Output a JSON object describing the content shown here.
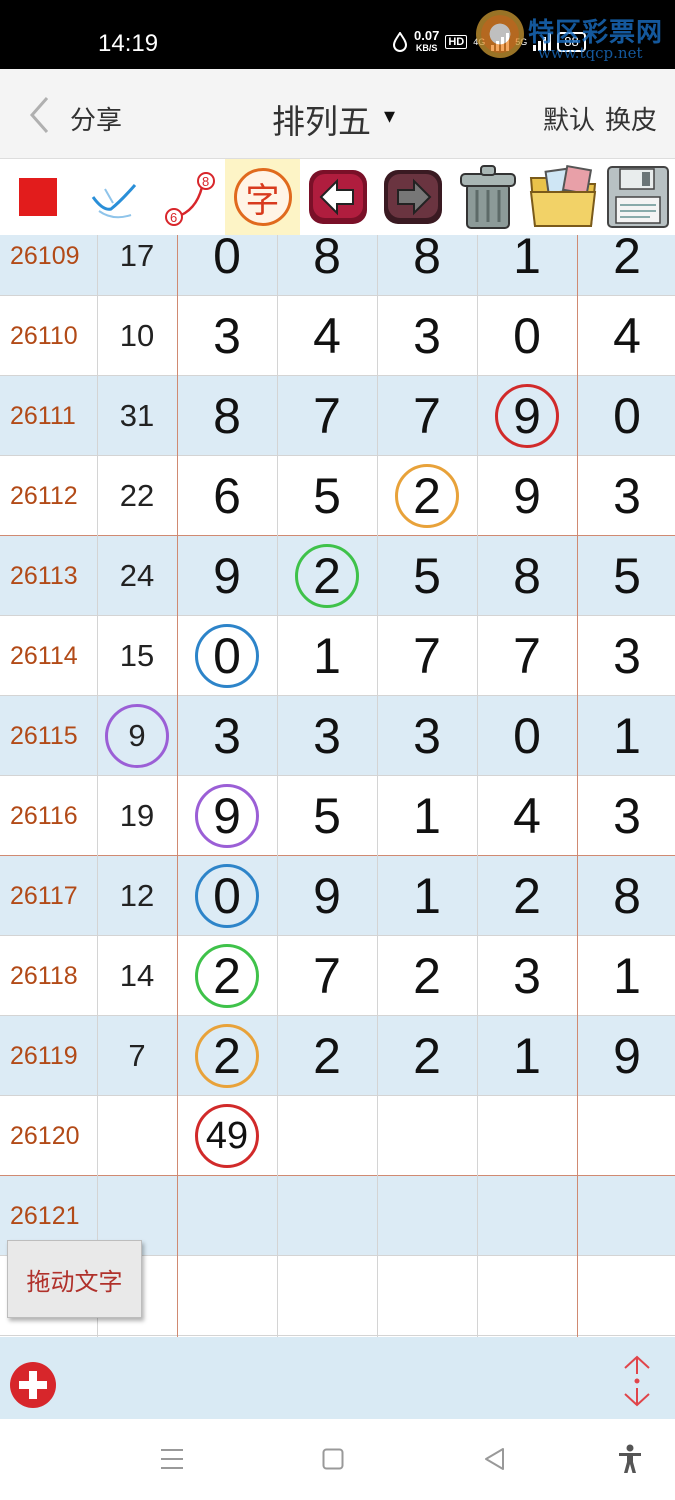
{
  "status_bar": {
    "time": "14:19",
    "net_speed": "0.07",
    "net_unit": "KB/S",
    "hd": "HD",
    "sig1": "4G",
    "sig2": "5G",
    "battery": "88"
  },
  "watermark": {
    "name": "特区彩票网",
    "url": "www.tqcp.net"
  },
  "title_bar": {
    "back_icon": "chevron-left-icon",
    "share_label": "分享",
    "title": "排列五",
    "title_arrow": "▾",
    "default_label": "默认",
    "skin_label": "换皮"
  },
  "toolbar": {
    "items": [
      "red-square-icon",
      "checkmark-icon",
      "trend-line-icon",
      "zi-character-icon",
      "arrow-left-icon",
      "arrow-right-icon",
      "trash-icon",
      "folder-images-icon",
      "floppy-save-icon"
    ],
    "trend_label_a": "8",
    "trend_label_b": "6",
    "zi_char": "字"
  },
  "table": {
    "rows": [
      {
        "period": "26109",
        "sum": "17",
        "digits": [
          "0",
          "8",
          "8",
          "1",
          "2"
        ]
      },
      {
        "period": "26110",
        "sum": "10",
        "digits": [
          "3",
          "4",
          "3",
          "0",
          "4"
        ]
      },
      {
        "period": "26111",
        "sum": "31",
        "digits": [
          "8",
          "7",
          "7",
          "9",
          "0"
        ]
      },
      {
        "period": "26112",
        "sum": "22",
        "digits": [
          "6",
          "5",
          "2",
          "9",
          "3"
        ]
      },
      {
        "period": "26113",
        "sum": "24",
        "digits": [
          "9",
          "2",
          "5",
          "8",
          "5"
        ]
      },
      {
        "period": "26114",
        "sum": "15",
        "digits": [
          "0",
          "1",
          "7",
          "7",
          "3"
        ]
      },
      {
        "period": "26115",
        "sum": "9",
        "digits": [
          "3",
          "3",
          "3",
          "0",
          "1"
        ]
      },
      {
        "period": "26116",
        "sum": "19",
        "digits": [
          "9",
          "5",
          "1",
          "4",
          "3"
        ]
      },
      {
        "period": "26117",
        "sum": "12",
        "digits": [
          "0",
          "9",
          "1",
          "2",
          "8"
        ]
      },
      {
        "period": "26118",
        "sum": "14",
        "digits": [
          "2",
          "7",
          "2",
          "3",
          "1"
        ]
      },
      {
        "period": "26119",
        "sum": "7",
        "digits": [
          "2",
          "2",
          "2",
          "1",
          "9"
        ]
      },
      {
        "period": "26120",
        "sum": "",
        "digits": [
          "49",
          "",
          "",
          "",
          ""
        ]
      },
      {
        "period": "26121",
        "sum": "",
        "digits": [
          "",
          "",
          "",
          "",
          ""
        ]
      },
      {
        "period": "",
        "sum": "",
        "digits": [
          "",
          "",
          "",
          "",
          ""
        ]
      }
    ],
    "circle_colors": {
      "red": "#d12a2a",
      "orange": "#e8a23a",
      "green": "#3fc24a",
      "blue": "#2d84c9",
      "purple": "#9b5fd6"
    }
  },
  "drag_button": {
    "label": "拖动文字"
  },
  "bottom_bar": {
    "add_icon": "plus-circle-icon",
    "updown_icon": "up-down-arrows-icon"
  },
  "nav_bar": {
    "items": [
      "menu-icon",
      "home-icon",
      "back-triangle-icon",
      "accessibility-icon"
    ]
  }
}
